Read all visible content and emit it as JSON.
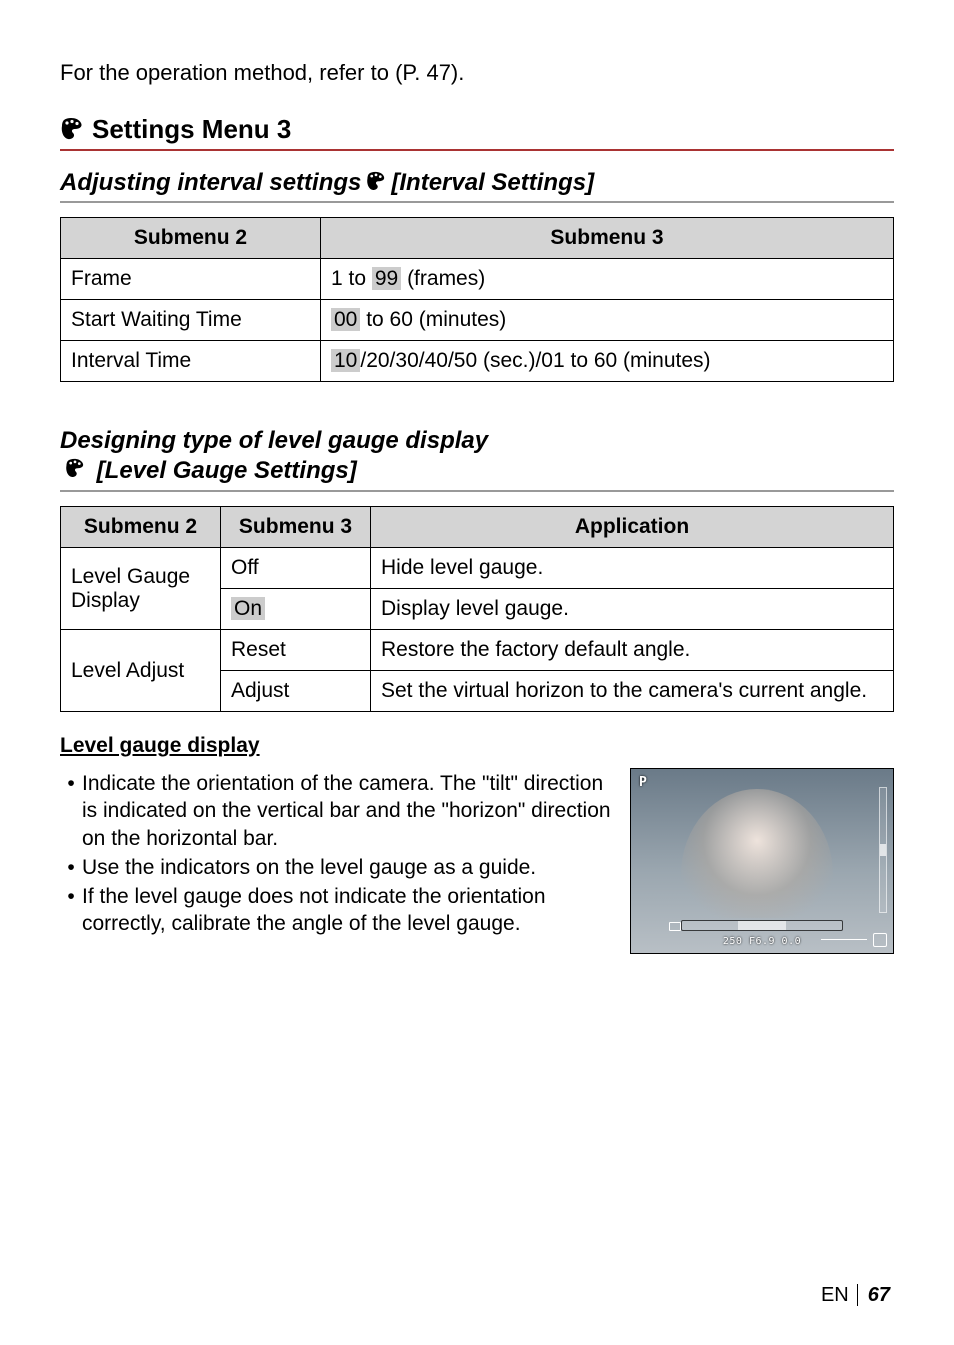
{
  "intro": "For the operation method, refer to (P. 47).",
  "menu_header": {
    "title": "Settings Menu 3"
  },
  "section_interval": {
    "title_pre": "Adjusting interval settings",
    "title_post": "[Interval Settings]",
    "headers": {
      "c1": "Submenu 2",
      "c2": "Submenu 3"
    },
    "rows": [
      {
        "k": "Frame",
        "pre": "1 to ",
        "hl": "99",
        "post": " (frames)"
      },
      {
        "k": "Start Waiting Time",
        "pre": "",
        "hl": "00",
        "post": " to 60 (minutes)"
      },
      {
        "k": "Interval Time",
        "pre": "",
        "hl": "10",
        "post": "/20/30/40/50 (sec.)/01 to 60 (minutes)"
      }
    ]
  },
  "section_level": {
    "title_line1": "Designing type of level gauge display",
    "title_line2": "[Level Gauge Settings]",
    "headers": {
      "c1": "Submenu 2",
      "c2": "Submenu 3",
      "c3": "Application"
    },
    "r1": {
      "span": "Level Gauge Display",
      "s3": "Off",
      "app": "Hide level gauge."
    },
    "r2": {
      "s3_hl": "On",
      "app": "Display level gauge."
    },
    "r3": {
      "span": "Level Adjust",
      "s3": "Reset",
      "app": "Restore the factory default angle."
    },
    "r4": {
      "s3": "Adjust",
      "app": "Set the virtual horizon to the camera's current angle."
    }
  },
  "lg_display": {
    "heading": "Level gauge display",
    "bullets": [
      "Indicate the orientation of the camera. The \"tilt\" direction is indicated on the vertical bar and the \"horizon\" direction on the horizontal bar.",
      "Use the indicators on the level gauge as a guide.",
      "If the level gauge does not indicate the orientation correctly, calibrate the angle of the level gauge."
    ]
  },
  "preview": {
    "mode": "P",
    "readout": "250  F6.9   0.0"
  },
  "footer": {
    "lang": "EN",
    "page": "67"
  }
}
